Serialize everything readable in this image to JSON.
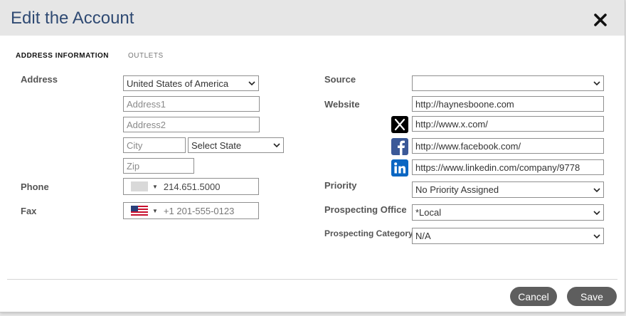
{
  "dialog": {
    "title": "Edit the Account"
  },
  "tabs": [
    {
      "label": "ADDRESS INFORMATION",
      "active": true
    },
    {
      "label": "OUTLETS",
      "active": false
    }
  ],
  "left": {
    "address_label": "Address",
    "country_value": "United States of America",
    "address1_placeholder": "Address1",
    "address2_placeholder": "Address2",
    "city_placeholder": "City",
    "state_value": "Select State",
    "zip_placeholder": "Zip",
    "phone_label": "Phone",
    "phone_value": "214.651.5000",
    "fax_label": "Fax",
    "fax_placeholder": "+1 201-555-0123"
  },
  "right": {
    "source_label": "Source",
    "source_value": "",
    "website_label": "Website",
    "website_value": "http://haynesboone.com",
    "x_value": "http://www.x.com/",
    "facebook_value": "http://www.facebook.com/",
    "linkedin_value": "https://www.linkedin.com/company/9778",
    "priority_label": "Priority",
    "priority_value": "No Priority Assigned",
    "prospecting_office_label": "Prospecting Office",
    "prospecting_office_value": "*Local",
    "prospecting_category_label": "Prospecting Category",
    "prospecting_category_value": "N/A"
  },
  "footer": {
    "cancel_label": "Cancel",
    "save_label": "Save"
  },
  "icons": {
    "close": "close-icon",
    "x": "x-logo-icon",
    "facebook": "facebook-icon",
    "linkedin": "linkedin-icon",
    "flag": "us-flag-icon",
    "chevron": "chevron-down-icon"
  },
  "colors": {
    "title": "#2f4a73",
    "header_bg": "#e6e6e6",
    "button_bg": "#5e5e5e",
    "facebook": "#3b5998",
    "linkedin": "#0a66c2",
    "x": "#000000"
  }
}
